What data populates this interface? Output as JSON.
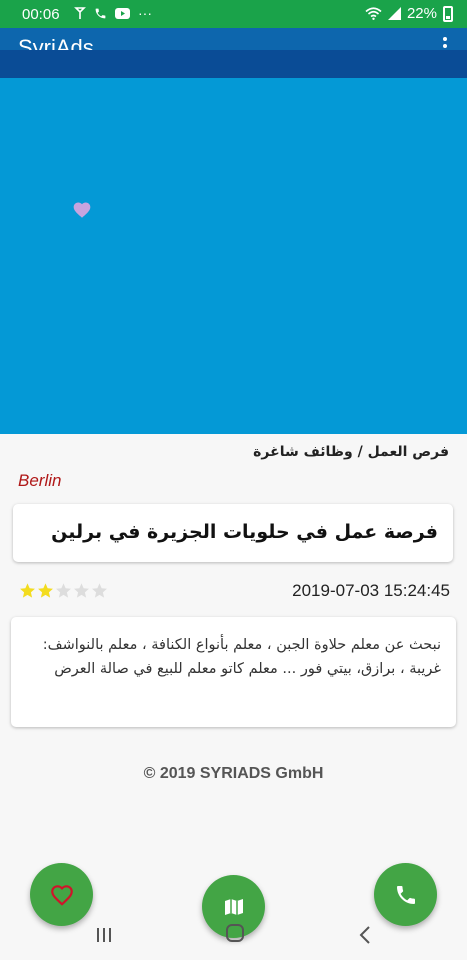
{
  "status_bar": {
    "time": "00:06",
    "dots": "···",
    "battery": "22%"
  },
  "app_bar": {
    "title": "SyriAds"
  },
  "breadcrumb": {
    "parent": "فرص العمل",
    "separator": "/",
    "child": "وظائف شاغرة"
  },
  "ad": {
    "city": "Berlin",
    "title": "فرصة عمل في حلويات الجزيرة في برلين",
    "rating": {
      "value": 2,
      "max": 5
    },
    "date": "2019-07-03 15:24:45",
    "description": "نبحث عن معلم حلاوة الجبن ، معلم بأنواع الكنافة ، معلم بالنواشف: غريبة ، برازق، بيتي فور ... معلم كاتو معلم للبيع في صالة العرض"
  },
  "footer": {
    "copyright": "© 2019 SYRIADS GmbH"
  },
  "colors": {
    "status_bar": "#1aa34a",
    "app_bar": "#0d66ad",
    "hero": "#0499d6",
    "fab": "#43a545",
    "city": "#b01818",
    "star_filled": "#f3dc1f",
    "star_empty": "#dddddd"
  },
  "icons": {
    "hero_favorite": "heart-icon",
    "fab_favorite": "heart-outline-icon",
    "fab_map": "map-icon",
    "fab_call": "phone-icon"
  }
}
